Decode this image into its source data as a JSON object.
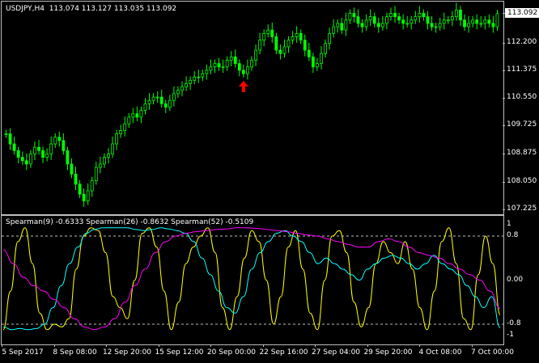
{
  "main_chart": {
    "symbol_info": "USDJPY,H4",
    "ohlc": "113.074 113.127 113.035 113.092",
    "current_price": "113.092",
    "price_labels": [
      "113.092",
      "112.200",
      "111.375",
      "110.550",
      "109.725",
      "108.875",
      "108.050",
      "107.225"
    ],
    "price_values": [
      113.092,
      112.2,
      111.375,
      110.55,
      109.725,
      108.875,
      108.05,
      107.225
    ],
    "price_range": [
      107.1,
      113.45
    ],
    "candle_color": "#00ff00",
    "marker": {
      "icon": "up-arrow-icon",
      "color": "#ff0000"
    },
    "closes": [
      109.5,
      109.2,
      109.0,
      108.8,
      108.7,
      108.6,
      108.9,
      109.1,
      109.0,
      108.8,
      108.9,
      109.2,
      109.4,
      109.3,
      109.0,
      108.6,
      108.3,
      108.0,
      107.7,
      107.5,
      107.8,
      108.1,
      108.5,
      108.6,
      108.8,
      108.9,
      109.2,
      109.5,
      109.6,
      109.8,
      110.0,
      110.1,
      110.0,
      110.2,
      110.4,
      110.5,
      110.6,
      110.6,
      110.4,
      110.3,
      110.5,
      110.7,
      110.8,
      110.9,
      111.0,
      111.1,
      111.2,
      111.2,
      111.3,
      111.4,
      111.5,
      111.6,
      111.5,
      111.5,
      111.7,
      111.8,
      111.6,
      111.4,
      111.3,
      111.5,
      111.7,
      112.0,
      112.3,
      112.5,
      112.6,
      112.4,
      112.0,
      111.9,
      112.1,
      112.3,
      112.4,
      112.5,
      112.3,
      112.0,
      111.8,
      111.5,
      111.6,
      111.9,
      112.2,
      112.5,
      112.7,
      112.8,
      112.6,
      112.9,
      113.1,
      113.0,
      112.8,
      112.7,
      112.9,
      113.0,
      112.8,
      112.7,
      112.8,
      113.0,
      113.1,
      113.0,
      112.9,
      112.8,
      112.8,
      112.9,
      113.0,
      113.1,
      113.0,
      112.8,
      112.7,
      112.7,
      112.8,
      112.9,
      112.9,
      113.0,
      113.2,
      112.9,
      112.7,
      112.8,
      112.9,
      112.8,
      112.8,
      112.9,
      112.8,
      112.7,
      113.09
    ]
  },
  "indicator": {
    "title": "Spearman(9) -0.6333  Spearman(26) -0.8632  Spearman(52) -0.5109",
    "levels": [
      {
        "label": "1",
        "value": 1
      },
      {
        "label": "0.8",
        "value": 0.8
      },
      {
        "label": "0.00",
        "value": 0
      },
      {
        "label": "-0.8",
        "value": -0.8
      },
      {
        "label": "-1",
        "value": -1
      }
    ],
    "series": [
      {
        "name": "Spearman(9)",
        "color": "#ffff00",
        "values": [
          -0.9,
          -0.2,
          0.7,
          0.95,
          0.3,
          -0.6,
          -0.9,
          -0.8,
          -0.85,
          -0.7,
          0.2,
          0.8,
          0.95,
          0.9,
          0.5,
          -0.3,
          -0.5,
          -0.7,
          0.0,
          0.85,
          0.95,
          0.6,
          -0.2,
          -0.9,
          -0.4,
          0.3,
          0.6,
          0.8,
          0.95,
          0.5,
          -0.5,
          -0.9,
          -0.3,
          0.4,
          0.9,
          0.7,
          0.0,
          -0.8,
          -0.3,
          0.6,
          0.9,
          0.2,
          -0.6,
          -0.9,
          0.0,
          0.8,
          0.9,
          0.5,
          -0.4,
          -0.85,
          -0.5,
          0.3,
          0.7,
          0.5,
          0.3,
          0.7,
          0.2,
          -0.5,
          -0.9,
          -0.2,
          0.7,
          0.95,
          0.3,
          -0.7,
          -0.9,
          0.1,
          0.8,
          0.3,
          -0.63
        ]
      },
      {
        "name": "Spearman(26)",
        "color": "#00ffff",
        "values": [
          -0.85,
          -0.9,
          -0.88,
          -0.9,
          -0.88,
          -0.8,
          -0.5,
          -0.1,
          0.3,
          0.6,
          0.85,
          0.92,
          0.95,
          0.95,
          0.95,
          0.95,
          0.92,
          0.9,
          0.92,
          0.95,
          0.93,
          0.9,
          0.85,
          0.7,
          0.4,
          0.1,
          -0.2,
          -0.5,
          -0.6,
          -0.3,
          0.2,
          0.5,
          0.7,
          0.85,
          0.9,
          0.8,
          0.7,
          0.5,
          0.3,
          0.4,
          0.3,
          0.2,
          0.1,
          0.0,
          0.2,
          0.3,
          0.4,
          0.45,
          0.4,
          0.3,
          0.2,
          0.3,
          0.45,
          0.3,
          0.2,
          0.1,
          -0.1,
          -0.3,
          -0.5,
          -0.3,
          -0.863
        ]
      },
      {
        "name": "Spearman(52)",
        "color": "#ff00ff",
        "values": [
          0.55,
          0.3,
          0.05,
          -0.1,
          -0.2,
          -0.35,
          -0.5,
          -0.7,
          -0.85,
          -0.9,
          -0.85,
          -0.7,
          -0.4,
          -0.1,
          0.2,
          0.5,
          0.7,
          0.8,
          0.85,
          0.88,
          0.9,
          0.92,
          0.93,
          0.95,
          0.95,
          0.94,
          0.92,
          0.9,
          0.88,
          0.85,
          0.82,
          0.8,
          0.75,
          0.7,
          0.65,
          0.6,
          0.6,
          0.7,
          0.75,
          0.7,
          0.6,
          0.5,
          0.45,
          0.4,
          0.3,
          0.2,
          0.1,
          0.0,
          -0.2,
          -0.511
        ]
      }
    ]
  },
  "time_axis": {
    "labels": [
      "5 Sep 2017",
      "8 Sep 08:00",
      "12 Sep 20:00",
      "15 Sep 12:00",
      "20 Sep 00:00",
      "22 Sep 16:00",
      "27 Sep 04:00",
      "29 Sep 20:00",
      "4 Oct 08:00",
      "7 Oct 00:00"
    ]
  }
}
